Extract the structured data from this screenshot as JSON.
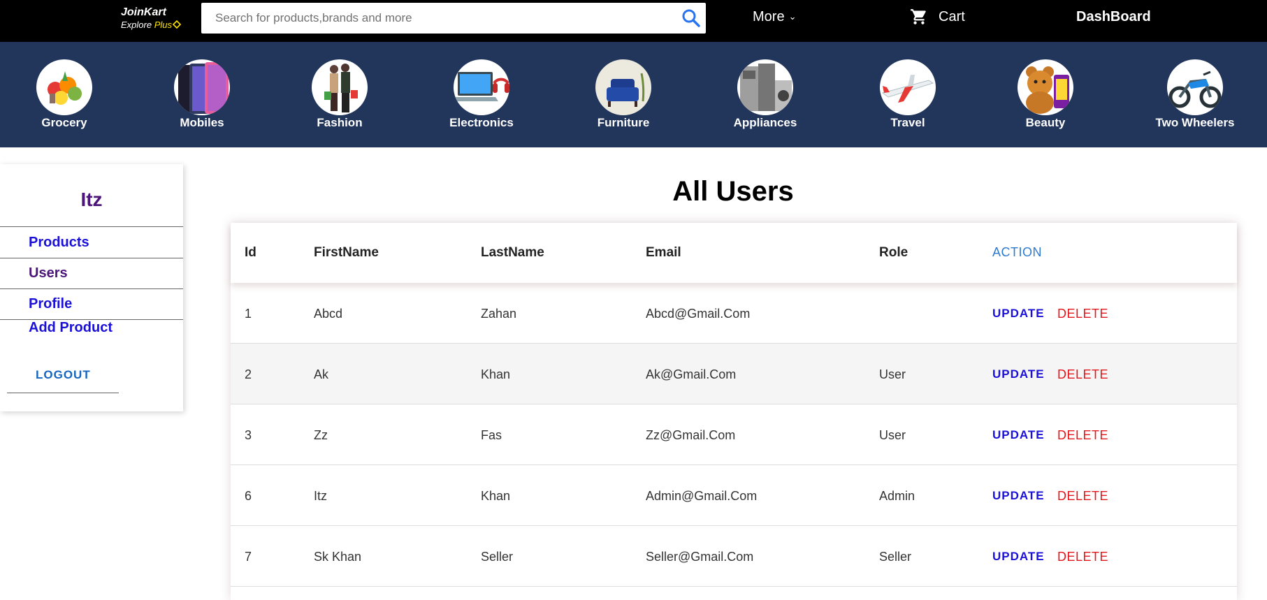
{
  "header": {
    "logo_title": "JoinKart",
    "logo_sub_prefix": "Explore",
    "logo_sub_plus": "Plus",
    "search_placeholder": "Search for products,brands and more",
    "more_label": "More",
    "cart_label": "Cart",
    "dashboard_label": "DashBoard"
  },
  "categories": [
    {
      "label": "Grocery",
      "icon": "grocery-image"
    },
    {
      "label": "Mobiles",
      "icon": "mobiles-image"
    },
    {
      "label": "Fashion",
      "icon": "fashion-image"
    },
    {
      "label": "Electronics",
      "icon": "electronics-image"
    },
    {
      "label": "Furniture",
      "icon": "furniture-image"
    },
    {
      "label": "Appliances",
      "icon": "appliances-image"
    },
    {
      "label": "Travel",
      "icon": "travel-image"
    },
    {
      "label": "Beauty",
      "icon": "beauty-image"
    },
    {
      "label": "Two Wheelers",
      "icon": "two-wheelers-image"
    }
  ],
  "sidebar": {
    "username": "Itz",
    "items": [
      {
        "label": "Products"
      },
      {
        "label": "Users"
      },
      {
        "label": "Profile"
      },
      {
        "label": "Add Product"
      }
    ],
    "logout_label": "LOGOUT"
  },
  "main": {
    "title": "All Users",
    "columns": [
      "Id",
      "FirstName",
      "LastName",
      "Email",
      "Role",
      "ACTION"
    ],
    "update_label": "UPDATE",
    "delete_label": "DELETE",
    "rows": [
      {
        "id": "1",
        "first": "Abcd",
        "last": "Zahan",
        "email": "Abcd@Gmail.Com",
        "role": ""
      },
      {
        "id": "2",
        "first": "Ak",
        "last": "Khan",
        "email": "Ak@Gmail.Com",
        "role": "User"
      },
      {
        "id": "3",
        "first": "Zz",
        "last": "Fas",
        "email": "Zz@Gmail.Com",
        "role": "User"
      },
      {
        "id": "6",
        "first": "Itz",
        "last": "Khan",
        "email": "Admin@Gmail.Com",
        "role": "Admin"
      },
      {
        "id": "7",
        "first": "Sk Khan",
        "last": "Seller",
        "email": "Seller@Gmail.Com",
        "role": "Seller"
      }
    ]
  },
  "colors": {
    "topbar": "#000000",
    "catbar": "#22355b",
    "sidebar_link": "#1a10d8",
    "sidebar_active": "#4b1579",
    "update": "#1a10d8",
    "delete": "#e3161b",
    "action_header": "#2e7ad1"
  }
}
